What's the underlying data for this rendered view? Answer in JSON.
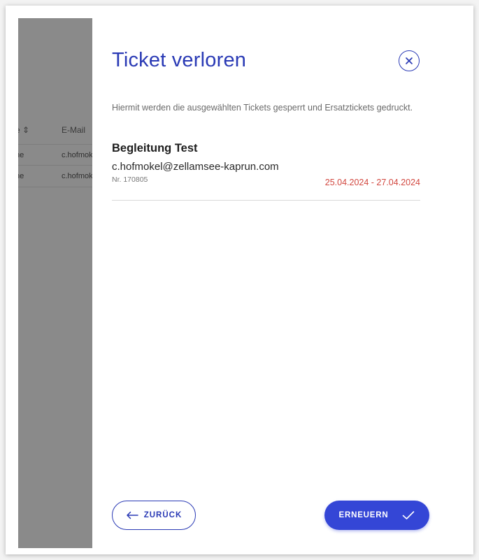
{
  "background_table": {
    "header": {
      "col1": "e ⇕",
      "col2": "E-Mail"
    },
    "rows": [
      {
        "col1": "he",
        "col2": "c.hofmokel"
      },
      {
        "col1": "he",
        "col2": "c.hofmokel"
      }
    ]
  },
  "dialog": {
    "title": "Ticket verloren",
    "description": "Hiermit werden die ausgewählten Tickets gesperrt und Ersatztickets gedruckt.",
    "ticket": {
      "name": "Begleitung Test",
      "email": "c.hofmokel@zellamsee-kaprun.com",
      "number": "Nr. 170805",
      "date_range": "25.04.2024 - 27.04.2024"
    },
    "back_label": "ZURÜCK",
    "renew_label": "ERNEUERN"
  },
  "icons": {
    "close": "close-circle-icon",
    "back": "arrow-left-icon",
    "renew": "checkmark-icon"
  },
  "colors": {
    "accent": "#2a3ab5",
    "primary_button": "#3446d6",
    "date": "#d2473f",
    "backdrop": "#8a8a8a"
  }
}
